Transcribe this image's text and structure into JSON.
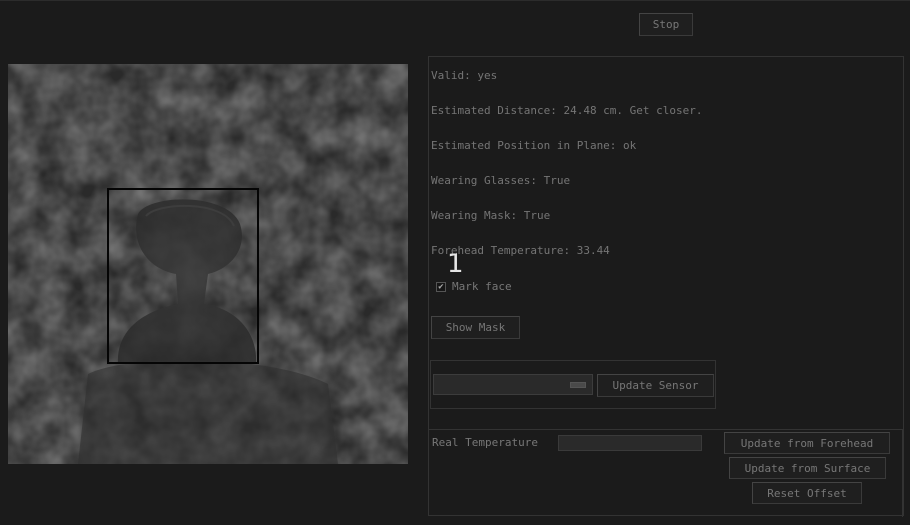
{
  "controls": {
    "stop_label": "Stop",
    "show_mask_label": "Show Mask",
    "update_sensor_label": "Update Sensor",
    "update_forehead_label": "Update from Forehead",
    "update_surface_label": "Update from Surface",
    "reset_offset_label": "Reset Offset"
  },
  "camera": {
    "face_id": "1"
  },
  "status": {
    "valid": "Valid: yes",
    "distance": "Estimated Distance: 24.48 cm. Get closer.",
    "position": "Estimated Position in Plane: ok",
    "glasses": "Wearing Glasses: True",
    "mask": "Wearing Mask: True",
    "forehead_temp": "Forehead Temperature: 33.44"
  },
  "options": {
    "mark_face_label": "Mark face",
    "mark_face_checked": true,
    "checkmark_glyph": "✔"
  },
  "sensor": {
    "selected_value": "",
    "dropdown_icon": "chevron-down-icon"
  },
  "calibration": {
    "real_temp_label": "Real Temperature",
    "real_temp_value": ""
  }
}
